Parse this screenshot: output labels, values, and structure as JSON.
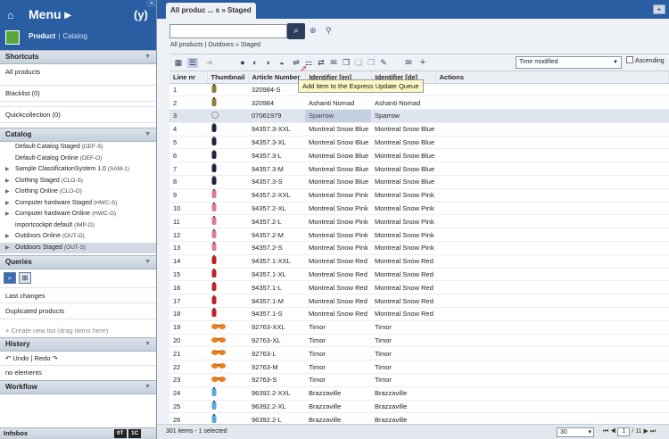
{
  "sidebar": {
    "menu_title": "Menu",
    "perspective": {
      "active": "Product",
      "other": "Catalog"
    },
    "shortcuts": {
      "title": "Shortcuts",
      "items": [
        "All products",
        "Blacklist (0)",
        "Quickcollection (0)"
      ]
    },
    "catalog": {
      "title": "Catalog",
      "items": [
        {
          "name": "Default-Catalog Staged",
          "code": "(DEF-S)",
          "expandable": false
        },
        {
          "name": "Default-Catalog Online",
          "code": "(DEF-O)",
          "expandable": false
        },
        {
          "name": "Sample ClassificationSystem 1.0",
          "code": "(SAM-1)",
          "expandable": true
        },
        {
          "name": "Clothing Staged",
          "code": "(CLO-S)",
          "expandable": true
        },
        {
          "name": "Clothing Online",
          "code": "(CLO-O)",
          "expandable": true
        },
        {
          "name": "Computer hardware Staged",
          "code": "(HWC-S)",
          "expandable": true
        },
        {
          "name": "Computer hardware Online",
          "code": "(HWC-O)",
          "expandable": true
        },
        {
          "name": "importcockpit default",
          "code": "(IMP-D)",
          "expandable": false
        },
        {
          "name": "Outdoors Online",
          "code": "(OUT-O)",
          "expandable": true
        },
        {
          "name": "Outdoors Staged",
          "code": "(OUT-S)",
          "expandable": true
        }
      ]
    },
    "queries": {
      "title": "Queries",
      "items": [
        "Last changes",
        "Duplicated products"
      ],
      "create_hint": "+ Create new list (drag items here)"
    },
    "history": {
      "title": "History",
      "undo": "Undo",
      "redo": "Redo",
      "empty": "no elements"
    },
    "workflow": {
      "title": "Workflow"
    },
    "infobox": {
      "title": "Infobox",
      "badge1": "0T",
      "badge2": "1C"
    }
  },
  "main": {
    "tab_title": "All produc ... s » Staged",
    "search": {
      "value": "",
      "placeholder": ""
    },
    "breadcrumb": "All products | Outdoors » Staged",
    "sort": {
      "value": "Time modified",
      "ascending_label": "Ascending"
    },
    "tooltip": "Add item to the Express Update Queue",
    "columns": [
      "Line nr",
      "Thumbnail",
      "Article Number",
      "Identifier [en]",
      "Identifier [de]",
      "Actions"
    ],
    "rows": [
      {
        "line": "1",
        "article": "320984-S",
        "en": "",
        "de": "",
        "thumb": "#8a7d3a"
      },
      {
        "line": "2",
        "article": "320984",
        "en": "Ashanti Nomad",
        "de": "Ashanti Nomad",
        "thumb": "#8a7d3a"
      },
      {
        "line": "3",
        "article": "07061979",
        "en": "Sparrow",
        "de": "Sparrow",
        "thumb": "#999999"
      },
      {
        "line": "4",
        "article": "94357.3-XXL",
        "en": "Montreal Snow Blue",
        "de": "Montreal Snow Blue",
        "thumb": "#1d2440"
      },
      {
        "line": "5",
        "article": "94357.3-XL",
        "en": "Montreal Snow Blue",
        "de": "Montreal Snow Blue",
        "thumb": "#1d2440"
      },
      {
        "line": "6",
        "article": "94357.3-L",
        "en": "Montreal Snow Blue",
        "de": "Montreal Snow Blue",
        "thumb": "#1d2440"
      },
      {
        "line": "7",
        "article": "94357.3-M",
        "en": "Montreal Snow Blue",
        "de": "Montreal Snow Blue",
        "thumb": "#1d2440"
      },
      {
        "line": "8",
        "article": "94357.3-S",
        "en": "Montreal Snow Blue",
        "de": "Montreal Snow Blue",
        "thumb": "#1d2440"
      },
      {
        "line": "9",
        "article": "94357.2-XXL",
        "en": "Montreal Snow Pink",
        "de": "Montreal Snow Pink",
        "thumb": "#e07a9a"
      },
      {
        "line": "10",
        "article": "94357.2-XL",
        "en": "Montreal Snow Pink",
        "de": "Montreal Snow Pink",
        "thumb": "#e07a9a"
      },
      {
        "line": "11",
        "article": "94357.2-L",
        "en": "Montreal Snow Pink",
        "de": "Montreal Snow Pink",
        "thumb": "#e07a9a"
      },
      {
        "line": "12",
        "article": "94357.2-M",
        "en": "Montreal Snow Pink",
        "de": "Montreal Snow Pink",
        "thumb": "#e07a9a"
      },
      {
        "line": "13",
        "article": "94357.2-S",
        "en": "Montreal Snow Pink",
        "de": "Montreal Snow Pink",
        "thumb": "#e07a9a"
      },
      {
        "line": "14",
        "article": "94357.1-XXL",
        "en": "Montreal Snow Red",
        "de": "Montreal Snow Red",
        "thumb": "#c41f28"
      },
      {
        "line": "15",
        "article": "94357.1-XL",
        "en": "Montreal Snow Red",
        "de": "Montreal Snow Red",
        "thumb": "#c41f28"
      },
      {
        "line": "16",
        "article": "94357.1-L",
        "en": "Montreal Snow Red",
        "de": "Montreal Snow Red",
        "thumb": "#c41f28"
      },
      {
        "line": "17",
        "article": "94357.1-M",
        "en": "Montreal Snow Red",
        "de": "Montreal Snow Red",
        "thumb": "#c41f28"
      },
      {
        "line": "18",
        "article": "94357.1-S",
        "en": "Montreal Snow Red",
        "de": "Montreal Snow Red",
        "thumb": "#c41f28"
      },
      {
        "line": "19",
        "article": "92763-XXL",
        "en": "Timor",
        "de": "Timor",
        "thumb": "#e8801c"
      },
      {
        "line": "20",
        "article": "92763-XL",
        "en": "Timor",
        "de": "Timor",
        "thumb": "#e8801c"
      },
      {
        "line": "21",
        "article": "92763-L",
        "en": "Timor",
        "de": "Timor",
        "thumb": "#e8801c"
      },
      {
        "line": "22",
        "article": "92763-M",
        "en": "Timor",
        "de": "Timor",
        "thumb": "#e8801c"
      },
      {
        "line": "23",
        "article": "92763-S",
        "en": "Timor",
        "de": "Timor",
        "thumb": "#e8801c"
      },
      {
        "line": "24",
        "article": "96392.2-XXL",
        "en": "Brazzaville",
        "de": "Brazzaville",
        "thumb": "#5aa7d8"
      },
      {
        "line": "25",
        "article": "96392.2-XL",
        "en": "Brazzaville",
        "de": "Brazzaville",
        "thumb": "#5aa7d8"
      },
      {
        "line": "26",
        "article": "96392.2-L",
        "en": "Brazzaville",
        "de": "Brazzaville",
        "thumb": "#5aa7d8"
      }
    ],
    "selected_line": "3",
    "status": "301 items - 1 selected",
    "page_size": "30",
    "page_current": "1",
    "page_total": "/ 11"
  },
  "colors": {
    "brand": "#2a5ea3",
    "header": "#c5cfdc",
    "selected": "#dfe5ee"
  }
}
